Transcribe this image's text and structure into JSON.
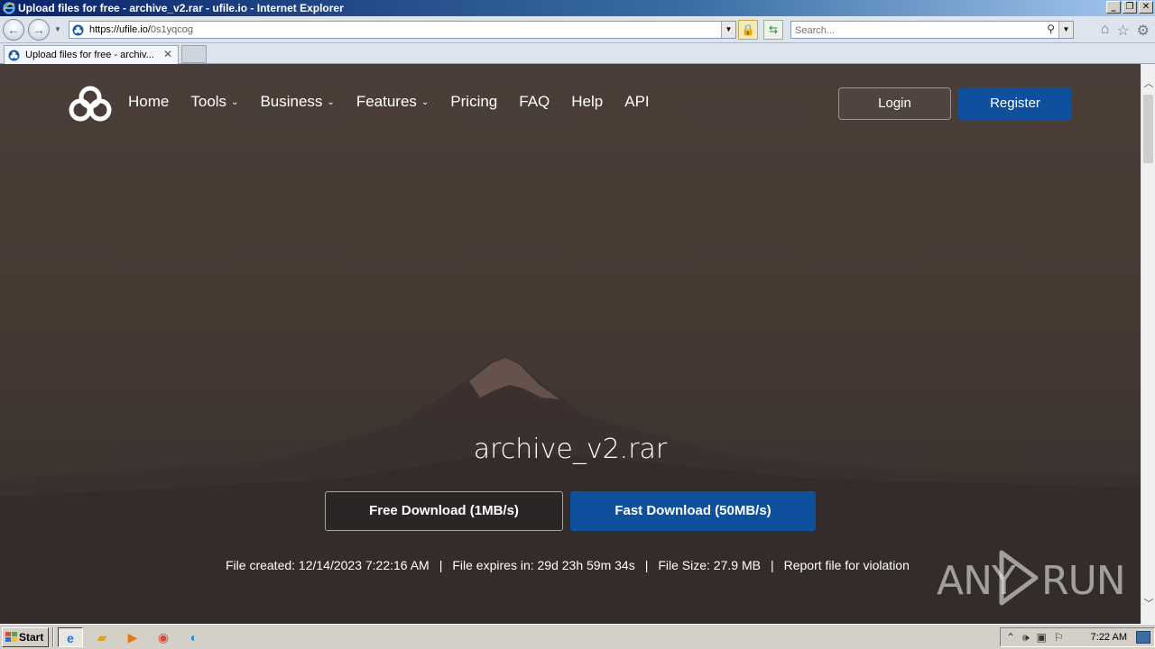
{
  "window": {
    "title": "Upload files for free - archive_v2.rar - ufile.io - Internet Explorer",
    "controls": [
      "_",
      "❐",
      "✕"
    ]
  },
  "address_bar": {
    "url_host": "https://ufile.io/",
    "url_path": "0s1yqcog"
  },
  "search": {
    "placeholder": "Search..."
  },
  "tabs": [
    {
      "label": "Upload files for free - archiv...",
      "active": true
    }
  ],
  "site": {
    "nav": [
      {
        "label": "Home",
        "dropdown": false
      },
      {
        "label": "Tools",
        "dropdown": true
      },
      {
        "label": "Business",
        "dropdown": true
      },
      {
        "label": "Features",
        "dropdown": true
      },
      {
        "label": "Pricing",
        "dropdown": false
      },
      {
        "label": "FAQ",
        "dropdown": false
      },
      {
        "label": "Help",
        "dropdown": false
      },
      {
        "label": "API",
        "dropdown": false
      }
    ],
    "login_label": "Login",
    "register_label": "Register",
    "accent_color": "#0e4f9e"
  },
  "file": {
    "name": "archive_v2.rar",
    "free_download_label": "Free Download (1MB/s)",
    "fast_download_label": "Fast Download (50MB/s)",
    "created": "File created: 12/14/2023 7:22:16 AM",
    "expires": "File expires in: 29d 23h 59m 34s",
    "size": "File Size: 27.9 MB",
    "report": "Report file for violation",
    "separator": "|"
  },
  "watermark": {
    "left": "ANY",
    "right": "RUN"
  },
  "taskbar": {
    "start_label": "Start",
    "apps": [
      "ie-icon",
      "folder-icon",
      "media-player-icon",
      "chrome-icon",
      "edge-icon"
    ],
    "clock": "7:22 AM"
  }
}
